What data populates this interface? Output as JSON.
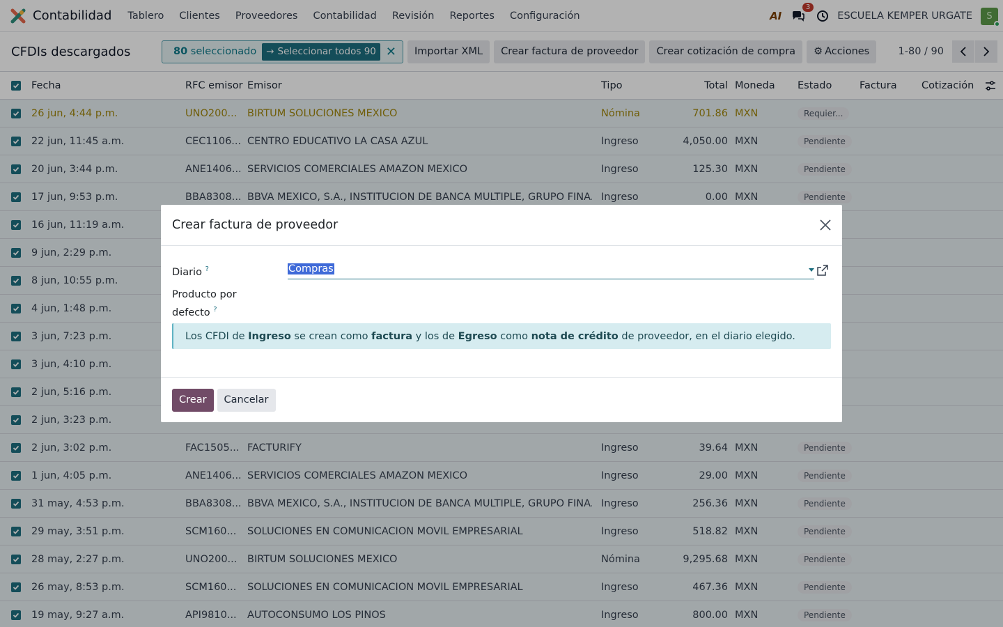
{
  "navbar": {
    "app_name": "Contabilidad",
    "menu": [
      "Tablero",
      "Clientes",
      "Proveedores",
      "Contabilidad",
      "Revisión",
      "Reportes",
      "Configuración"
    ],
    "ai_label": "AI",
    "messages_count": "3",
    "company": "ESCUELA KEMPER URGATE",
    "avatar_letter": "S"
  },
  "control": {
    "title": "CFDIs descargados",
    "selected_count": "80",
    "selected_label": "seleccionado",
    "select_all": "Seleccionar todos 90",
    "buttons": [
      "Importar XML",
      "Crear factura de proveedor",
      "Crear cotización de compra"
    ],
    "actions": "Acciones",
    "pager": "1-80 / 90"
  },
  "table": {
    "headers": {
      "fecha": "Fecha",
      "rfc": "RFC emisor",
      "emisor": "Emisor",
      "tipo": "Tipo",
      "total": "Total",
      "moneda": "Moneda",
      "estado": "Estado",
      "factura": "Factura",
      "cotizacion": "Cotización"
    },
    "rows": [
      {
        "fecha": "26 jun, 4:44 p.m.",
        "rfc": "UNO200...",
        "emisor": "BIRTUM SOLUCIONES MEXICO",
        "tipo": "Nómina",
        "total": "701.86",
        "moneda": "MXN",
        "estado": "Requier...",
        "warn": true
      },
      {
        "fecha": "22 jun, 11:45 a.m.",
        "rfc": "CEC1106...",
        "emisor": "CENTRO EDUCATIVO LA CASA AZUL",
        "tipo": "Ingreso",
        "total": "4,050.00",
        "moneda": "MXN",
        "estado": "Pendiente"
      },
      {
        "fecha": "20 jun, 3:44 p.m.",
        "rfc": "ANE1406...",
        "emisor": "SERVICIOS COMERCIALES AMAZON MEXICO",
        "tipo": "Ingreso",
        "total": "125.30",
        "moneda": "MXN",
        "estado": "Pendiente"
      },
      {
        "fecha": "17 jun, 9:53 p.m.",
        "rfc": "BBA8308...",
        "emisor": "BBVA MEXICO, S.A., INSTITUCION DE BANCA MULTIPLE, GRUPO FINA...",
        "tipo": "Ingreso",
        "total": "0.00",
        "moneda": "MXN",
        "estado": "Pendiente"
      },
      {
        "fecha": "16 jun, 11:19 a.m.",
        "rfc": "",
        "emisor": "",
        "tipo": "",
        "total": "",
        "moneda": "",
        "estado": ""
      },
      {
        "fecha": "9 jun, 2:29 p.m.",
        "rfc": "",
        "emisor": "",
        "tipo": "",
        "total": "",
        "moneda": "",
        "estado": ""
      },
      {
        "fecha": "8 jun, 10:55 p.m.",
        "rfc": "",
        "emisor": "",
        "tipo": "",
        "total": "",
        "moneda": "",
        "estado": ""
      },
      {
        "fecha": "4 jun, 1:48 p.m.",
        "rfc": "",
        "emisor": "",
        "tipo": "",
        "total": "",
        "moneda": "",
        "estado": ""
      },
      {
        "fecha": "3 jun, 7:23 p.m.",
        "rfc": "",
        "emisor": "",
        "tipo": "",
        "total": "",
        "moneda": "",
        "estado": ""
      },
      {
        "fecha": "3 jun, 4:10 p.m.",
        "rfc": "",
        "emisor": "",
        "tipo": "",
        "total": "",
        "moneda": "",
        "estado": ""
      },
      {
        "fecha": "2 jun, 5:16 p.m.",
        "rfc": "",
        "emisor": "",
        "tipo": "",
        "total": "",
        "moneda": "",
        "estado": ""
      },
      {
        "fecha": "2 jun, 3:23 p.m.",
        "rfc": "",
        "emisor": "",
        "tipo": "",
        "total": "",
        "moneda": "",
        "estado": ""
      },
      {
        "fecha": "2 jun, 3:02 p.m.",
        "rfc": "FAC1505...",
        "emisor": "FACTURIFY",
        "tipo": "Ingreso",
        "total": "39.64",
        "moneda": "MXN",
        "estado": "Pendiente"
      },
      {
        "fecha": "1 jun, 4:05 p.m.",
        "rfc": "ANE1406...",
        "emisor": "SERVICIOS COMERCIALES AMAZON MEXICO",
        "tipo": "Ingreso",
        "total": "29.00",
        "moneda": "MXN",
        "estado": "Pendiente"
      },
      {
        "fecha": "31 may, 4:53 p.m.",
        "rfc": "BBA8308...",
        "emisor": "BBVA MEXICO, S.A., INSTITUCION DE BANCA MULTIPLE, GRUPO FINA...",
        "tipo": "Ingreso",
        "total": "256.36",
        "moneda": "MXN",
        "estado": "Pendiente"
      },
      {
        "fecha": "29 may, 3:51 p.m.",
        "rfc": "SCM160...",
        "emisor": "SOLUCIONES EN COMUNICACION MOVIL EMPRESARIAL",
        "tipo": "Ingreso",
        "total": "518.82",
        "moneda": "MXN",
        "estado": "Pendiente"
      },
      {
        "fecha": "28 may, 2:27 p.m.",
        "rfc": "UNO200...",
        "emisor": "BIRTUM SOLUCIONES MEXICO",
        "tipo": "Nómina",
        "total": "9,295.68",
        "moneda": "MXN",
        "estado": "Pendiente"
      },
      {
        "fecha": "26 may, 8:53 p.m.",
        "rfc": "SCM160...",
        "emisor": "SOLUCIONES EN COMUNICACION MOVIL EMPRESARIAL",
        "tipo": "Ingreso",
        "total": "467.36",
        "moneda": "MXN",
        "estado": "Pendiente"
      },
      {
        "fecha": "19 may, 9:27 a.m.",
        "rfc": "API9810...",
        "emisor": "AUTOCONSUMO LOS PINOS",
        "tipo": "Ingreso",
        "total": "800.00",
        "moneda": "MXN",
        "estado": "Pendiente"
      }
    ]
  },
  "modal": {
    "title": "Crear factura de proveedor",
    "diario_label": "Diario",
    "diario_value": "Compras",
    "producto_label_1": "Producto por",
    "producto_label_2": "defecto",
    "help_mark": "?",
    "info": {
      "p1": "Los CFDI de ",
      "b1": "Ingreso",
      "p2": " se crean como ",
      "b2": "factura",
      "p3": " y los de ",
      "b3": "Egreso",
      "p4": " como ",
      "b4": "nota de crédito",
      "p5": " de proveedor, en el diario elegido."
    },
    "create": "Crear",
    "cancel": "Cancelar"
  },
  "colors": {
    "primary": "#714b67",
    "accent": "#1d6f80",
    "info_bg": "#d6ecf0"
  }
}
